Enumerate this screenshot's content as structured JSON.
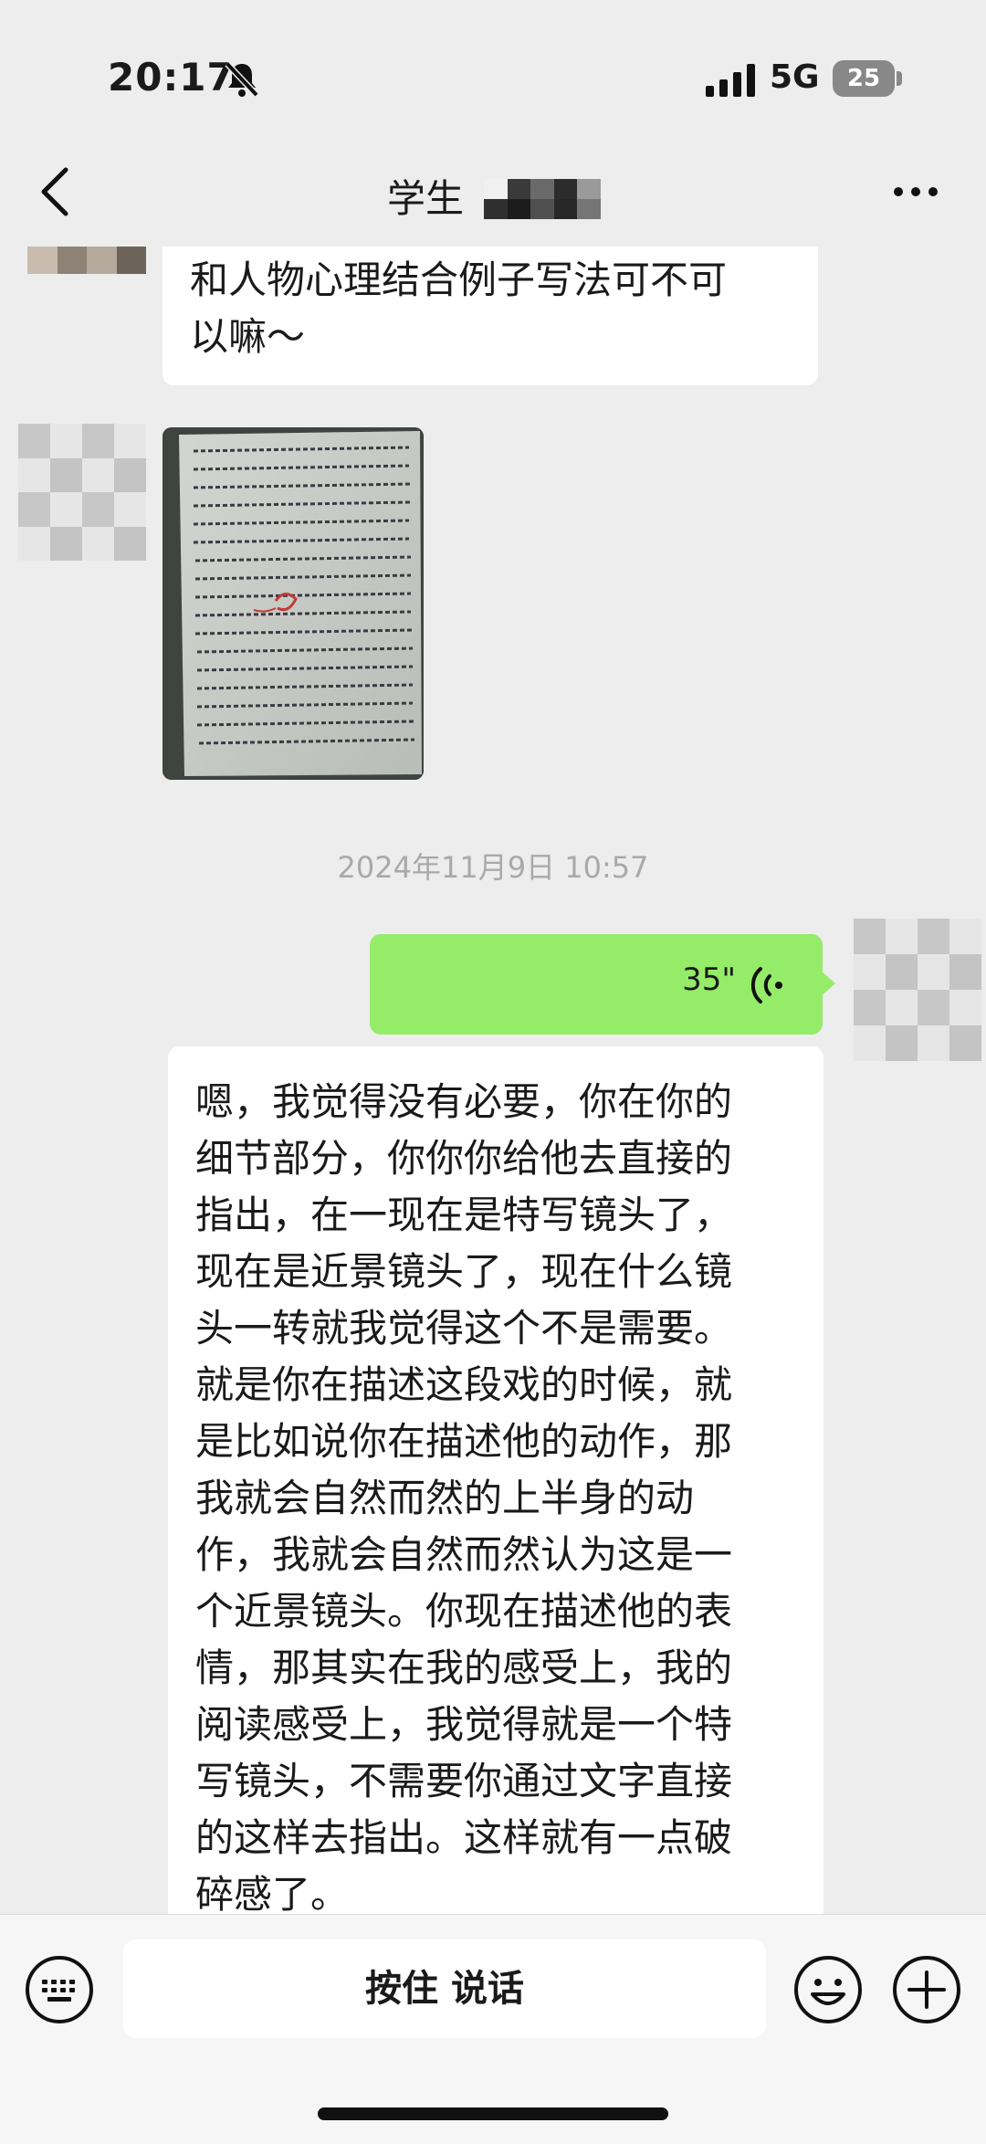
{
  "status_bar": {
    "time": "20:17",
    "network": "5G",
    "battery": "25",
    "icons": [
      "bell-muted-icon",
      "signal-icon"
    ]
  },
  "nav": {
    "title": "学生",
    "icons": [
      "back-chevron-icon",
      "more-icon"
    ]
  },
  "messages": [
    {
      "side": "received",
      "type": "text",
      "text": "和人物心理结合例子写法可不可\n以嘛～"
    },
    {
      "side": "received",
      "type": "image",
      "alt": "handwritten-essay-photo"
    },
    {
      "type": "timestamp",
      "text": "2024年11月9日 10:57"
    },
    {
      "side": "sent",
      "type": "voice",
      "duration": "35\"",
      "icon": "voice-wave-icon"
    },
    {
      "side": "received",
      "type": "text",
      "text": "嗯，我觉得没有必要，你在你的\n细节部分，你你你给他去直接的\n指出，在一现在是特写镜头了，\n现在是近景镜头了，现在什么镜\n头一转就我觉得这个不是需要。\n就是你在描述这段戏的时候，就\n是比如说你在描述他的动作，那\n我就会自然而然的上半身的动\n作，我就会自然而然认为这是一\n个近景镜头。你现在描述他的表\n情，那其实在我的感受上，我的\n阅读感受上，我觉得就是一个特\n写镜头，不需要你通过文字直接\n的这样去指出。这样就有一点破\n碎感了。"
    }
  ],
  "input_bar": {
    "hold_to_talk": "按住 说话",
    "icons": [
      "keyboard-icon",
      "emoji-icon",
      "plus-icon"
    ]
  },
  "colors": {
    "background": "#ededed",
    "sent_bubble": "#95ec69",
    "received_bubble": "#ffffff"
  }
}
